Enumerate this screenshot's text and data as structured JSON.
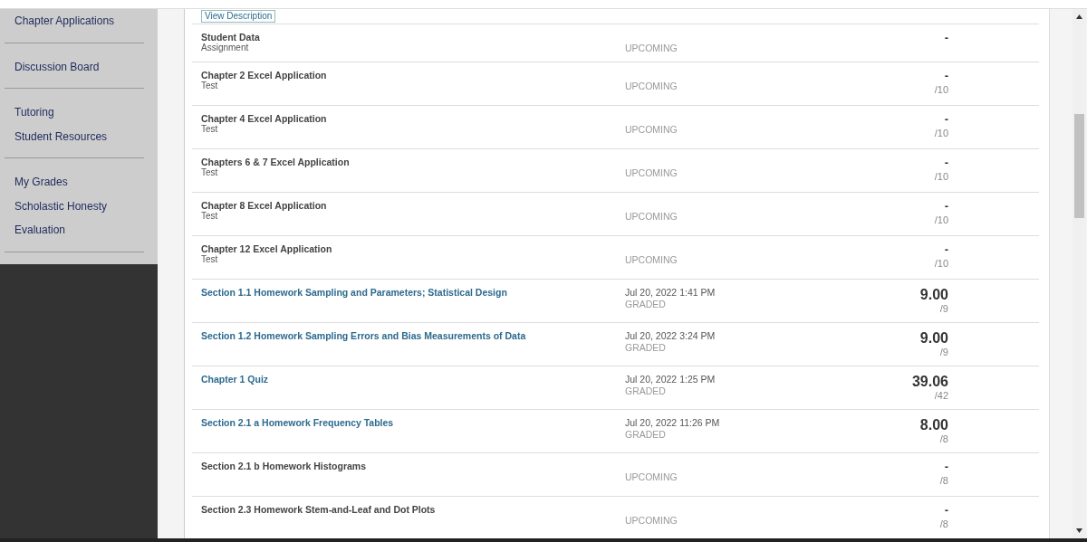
{
  "sidebar": {
    "groups": [
      {
        "items": [
          "Chapter Applications"
        ]
      },
      {
        "items": [
          "Discussion Board"
        ]
      },
      {
        "items": [
          "Tutoring",
          "Student Resources"
        ]
      },
      {
        "items": [
          "My Grades",
          "Scholastic Honesty",
          "Evaluation"
        ]
      }
    ]
  },
  "view_description_button": "View Description",
  "grades": [
    {
      "title": "Student Data",
      "subtitle": "Assignment",
      "link": false,
      "status": "UPCOMING",
      "score": "-"
    },
    {
      "title": "Chapter 2 Excel Application",
      "subtitle": "Test",
      "link": false,
      "status": "UPCOMING",
      "score": "-",
      "out_of": "/10"
    },
    {
      "title": "Chapter 4 Excel Application",
      "subtitle": "Test",
      "link": false,
      "status": "UPCOMING",
      "score": "-",
      "out_of": "/10"
    },
    {
      "title": "Chapters 6 & 7 Excel Application",
      "subtitle": "Test",
      "link": false,
      "status": "UPCOMING",
      "score": "-",
      "out_of": "/10"
    },
    {
      "title": "Chapter 8 Excel Application",
      "subtitle": "Test",
      "link": false,
      "status": "UPCOMING",
      "score": "-",
      "out_of": "/10"
    },
    {
      "title": "Chapter 12 Excel Application",
      "subtitle": "Test",
      "link": false,
      "status": "UPCOMING",
      "score": "-",
      "out_of": "/10"
    },
    {
      "title": "Section 1.1 Homework Sampling and Parameters; Statistical Design",
      "link": true,
      "date": "Jul 20, 2022 1:41 PM",
      "status": "GRADED",
      "score": "9.00",
      "out_of": "/9"
    },
    {
      "title": "Section 1.2 Homework Sampling Errors and Bias Measurements of Data",
      "link": true,
      "date": "Jul 20, 2022 3:24 PM",
      "status": "GRADED",
      "score": "9.00",
      "out_of": "/9"
    },
    {
      "title": "Chapter 1 Quiz",
      "link": true,
      "date": "Jul 20, 2022 1:25 PM",
      "status": "GRADED",
      "score": "39.06",
      "out_of": "/42"
    },
    {
      "title": "Section 2.1 a Homework Frequency Tables",
      "link": true,
      "date": "Jul 20, 2022 11:26 PM",
      "status": "GRADED",
      "score": "8.00",
      "out_of": "/8"
    },
    {
      "title": "Section 2.1 b Homework Histograms",
      "link": false,
      "status": "UPCOMING",
      "score": "-",
      "out_of": "/8"
    },
    {
      "title": "Section 2.3 Homework Stem-and-Leaf and Dot Plots",
      "link": false,
      "status": "UPCOMING",
      "score": "-",
      "out_of": "/8"
    }
  ]
}
